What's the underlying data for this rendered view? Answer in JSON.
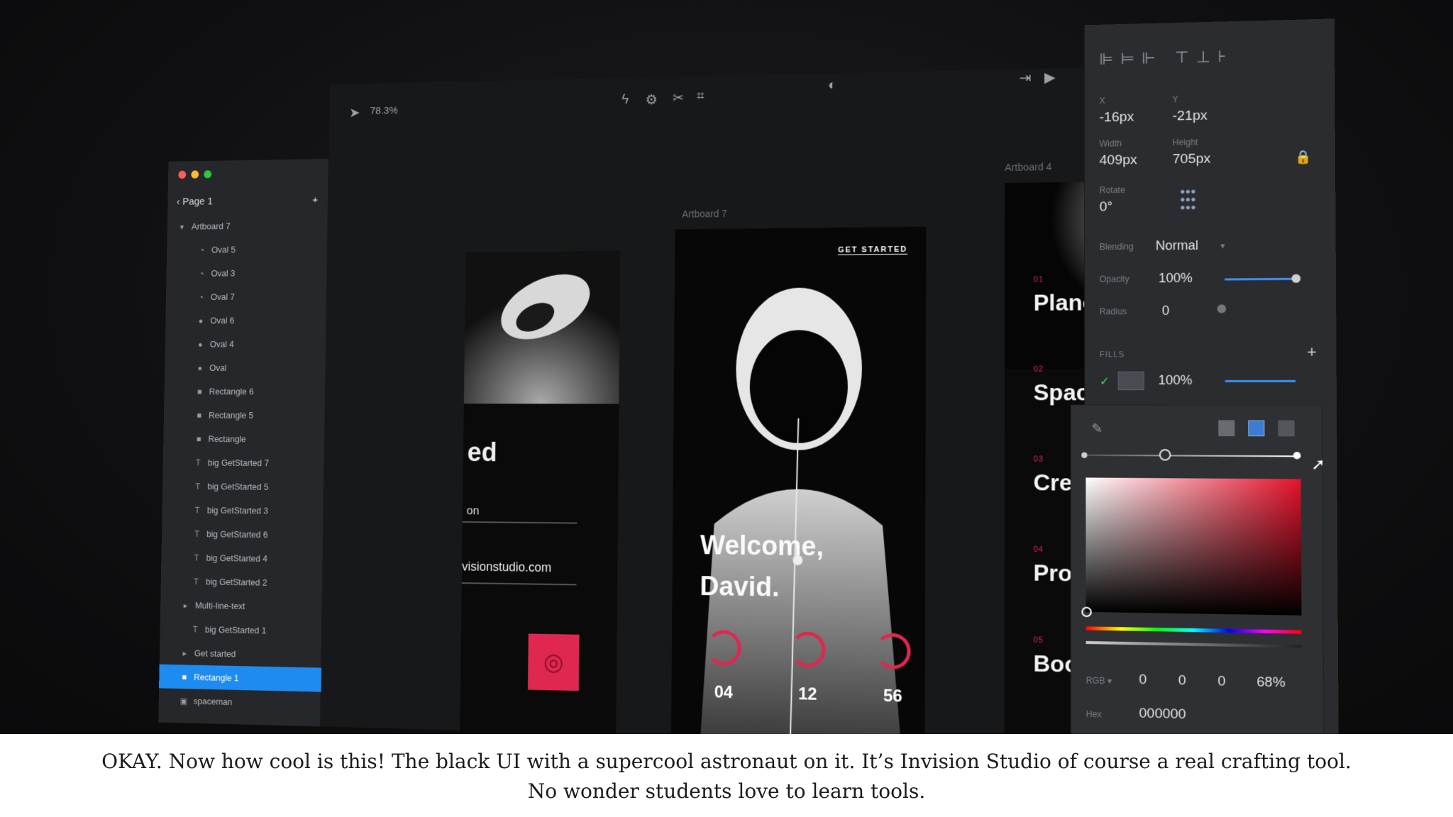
{
  "layers_panel": {
    "page_label": "Page 1",
    "add_label": "+",
    "items": [
      {
        "label": "Artboard 7",
        "icon": "caret-down-icon",
        "indent": 0
      },
      {
        "label": "Oval 5",
        "icon": "shape-icon",
        "indent": 2
      },
      {
        "label": "Oval 3",
        "icon": "shape-icon",
        "indent": 2
      },
      {
        "label": "Oval 7",
        "icon": "shape-icon",
        "indent": 2
      },
      {
        "label": "Oval 6",
        "icon": "circle-icon",
        "indent": 2
      },
      {
        "label": "Oval 4",
        "icon": "circle-icon",
        "indent": 2
      },
      {
        "label": "Oval",
        "icon": "circle-icon",
        "indent": 2
      },
      {
        "label": "Rectangle 6",
        "icon": "square-icon",
        "indent": 2
      },
      {
        "label": "Rectangle 5",
        "icon": "square-icon",
        "indent": 2
      },
      {
        "label": "Rectangle",
        "icon": "square-icon",
        "indent": 2
      },
      {
        "label": "big GetStarted 7",
        "icon": "text-icon",
        "indent": 2
      },
      {
        "label": "big GetStarted 5",
        "icon": "text-icon",
        "indent": 2
      },
      {
        "label": "big GetStarted 3",
        "icon": "text-icon",
        "indent": 2
      },
      {
        "label": "big GetStarted 6",
        "icon": "text-icon",
        "indent": 2
      },
      {
        "label": "big GetStarted 4",
        "icon": "text-icon",
        "indent": 2
      },
      {
        "label": "big GetStarted 2",
        "icon": "text-icon",
        "indent": 2
      },
      {
        "label": "Multi-line-text",
        "icon": "folder-icon",
        "indent": 1
      },
      {
        "label": "big GetStarted 1",
        "icon": "text-icon",
        "indent": 2
      },
      {
        "label": "Get started",
        "icon": "folder-icon",
        "indent": 1
      },
      {
        "label": "Rectangle 1",
        "icon": "square-icon",
        "indent": 1,
        "selected": true
      },
      {
        "label": "spaceman",
        "icon": "image-icon",
        "indent": 1
      }
    ]
  },
  "toolbar": {
    "zoom": "78.3%"
  },
  "canvas": {
    "artboard_center_label": "Artboard 7",
    "artboard_right_label": "Artboard 4",
    "left_board": {
      "title_fragment": "ed",
      "line_fragment": "on",
      "email_fragment": "visionstudio.com"
    },
    "center_board": {
      "cta": "GET STARTED",
      "welcome_line1": "Welcome,",
      "welcome_line2": "David.",
      "stats": [
        {
          "value": "04"
        },
        {
          "value": "12"
        },
        {
          "value": "56"
        }
      ]
    },
    "right_board": {
      "menu": [
        {
          "num": "01",
          "label": "Planets"
        },
        {
          "num": "02",
          "label": "Spacecraft"
        },
        {
          "num": "03",
          "label": "Crew"
        },
        {
          "num": "04",
          "label": "Profile"
        },
        {
          "num": "05",
          "label": "Book"
        }
      ]
    }
  },
  "inspector": {
    "x_label": "X",
    "x_value": "-16px",
    "y_label": "Y",
    "y_value": "-21px",
    "width_label": "Width",
    "width_value": "409px",
    "height_label": "Height",
    "height_value": "705px",
    "rotate_label": "Rotate",
    "rotate_value": "0°",
    "blending_label": "Blending",
    "blending_value": "Normal",
    "opacity_label": "Opacity",
    "opacity_value": "100%",
    "radius_label": "Radius",
    "radius_value": "0",
    "fills_label": "FILLS",
    "fill_opacity": "100%",
    "color_mode_label": "RGB",
    "r": "0",
    "g": "0",
    "b": "0",
    "a": "68%",
    "hex_label": "Hex",
    "hex_value": "000000"
  },
  "caption": {
    "line1": "OKAY. Now how cool is this! The black UI with a supercool astronaut on it. It’s Invision Studio of course a real crafting tool.",
    "line2": "No wonder students love to learn tools."
  },
  "colors": {
    "accent_red": "#e0274f",
    "selection_blue": "#1e8bf0",
    "mac_red": "#ff5f57",
    "mac_yellow": "#febc2e",
    "mac_green": "#28c840"
  }
}
